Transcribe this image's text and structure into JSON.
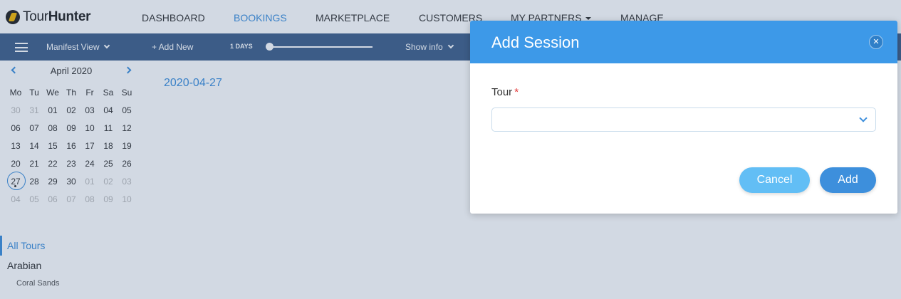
{
  "app": {
    "logo_text_light": "Tour",
    "logo_text_bold": "Hunter"
  },
  "nav": {
    "items": [
      {
        "label": "DASHBOARD",
        "active": false
      },
      {
        "label": "BOOKINGS",
        "active": true
      },
      {
        "label": "MARKETPLACE",
        "active": false
      },
      {
        "label": "CUSTOMERS",
        "active": false
      },
      {
        "label": "MY PARTNERS",
        "active": false,
        "dropdown": true
      },
      {
        "label": "MANAGE",
        "active": false
      }
    ]
  },
  "toolbar": {
    "view_label": "Manifest View",
    "add_new_label": "+ Add New",
    "days_label": "1 DAYS",
    "days_slider_value": 1,
    "show_info_label": "Show info"
  },
  "calendar": {
    "month_label": "April 2020",
    "weekdays": [
      "Mo",
      "Tu",
      "We",
      "Th",
      "Fr",
      "Sa",
      "Su"
    ],
    "weeks": [
      [
        {
          "d": "30",
          "m": true
        },
        {
          "d": "31",
          "m": true
        },
        {
          "d": "01"
        },
        {
          "d": "02"
        },
        {
          "d": "03"
        },
        {
          "d": "04"
        },
        {
          "d": "05"
        }
      ],
      [
        {
          "d": "06"
        },
        {
          "d": "07"
        },
        {
          "d": "08"
        },
        {
          "d": "09"
        },
        {
          "d": "10"
        },
        {
          "d": "11"
        },
        {
          "d": "12"
        }
      ],
      [
        {
          "d": "13"
        },
        {
          "d": "14"
        },
        {
          "d": "15"
        },
        {
          "d": "16"
        },
        {
          "d": "17"
        },
        {
          "d": "18"
        },
        {
          "d": "19"
        }
      ],
      [
        {
          "d": "20"
        },
        {
          "d": "21"
        },
        {
          "d": "22"
        },
        {
          "d": "23"
        },
        {
          "d": "24"
        },
        {
          "d": "25"
        },
        {
          "d": "26"
        }
      ],
      [
        {
          "d": "27",
          "today": true
        },
        {
          "d": "28"
        },
        {
          "d": "29"
        },
        {
          "d": "30"
        },
        {
          "d": "01",
          "m": true
        },
        {
          "d": "02",
          "m": true
        },
        {
          "d": "03",
          "m": true
        }
      ],
      [
        {
          "d": "04",
          "m": true
        },
        {
          "d": "05",
          "m": true
        },
        {
          "d": "06",
          "m": true
        },
        {
          "d": "07",
          "m": true
        },
        {
          "d": "08",
          "m": true
        },
        {
          "d": "09",
          "m": true
        },
        {
          "d": "10",
          "m": true
        }
      ]
    ]
  },
  "tours": {
    "all_label": "All Tours",
    "group_label": "Arabian",
    "sub_label": "Coral Sands"
  },
  "main": {
    "date_label": "2020-04-27"
  },
  "modal": {
    "title": "Add Session",
    "close_glyph": "✕",
    "tour_label": "Tour",
    "required_mark": "*",
    "tour_value": "",
    "cancel_label": "Cancel",
    "add_label": "Add"
  },
  "colors": {
    "accent": "#3d8fdc",
    "toolbar_bg": "#3f5f8a",
    "modal_header": "#3d99e8",
    "cancel_button": "#62bef5",
    "required": "#e23b3b"
  }
}
